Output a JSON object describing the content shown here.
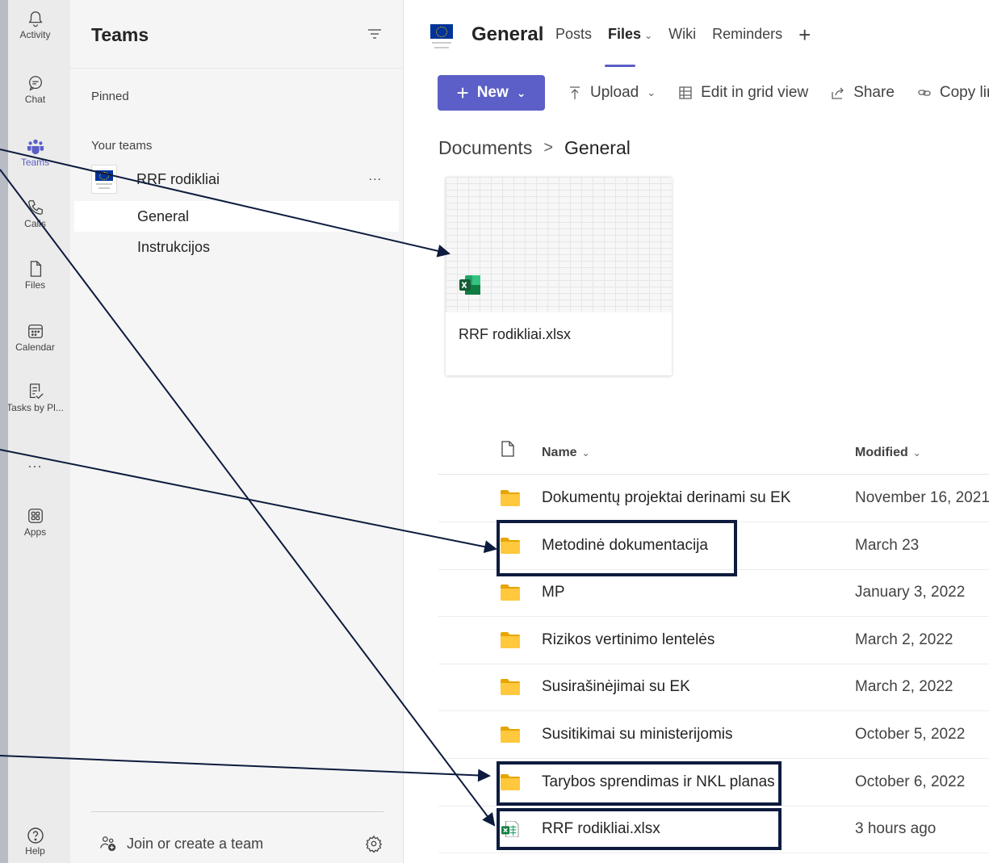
{
  "rail": {
    "items": [
      {
        "label": "Activity",
        "icon": "bell-icon"
      },
      {
        "label": "Chat",
        "icon": "chat-icon"
      },
      {
        "label": "Teams",
        "icon": "teams-icon",
        "active": true
      },
      {
        "label": "Calls",
        "icon": "phone-icon"
      },
      {
        "label": "Files",
        "icon": "file-icon"
      },
      {
        "label": "Calendar",
        "icon": "calendar-icon"
      },
      {
        "label": "Tasks by Pl...",
        "icon": "tasks-icon"
      },
      {
        "label": "Apps",
        "icon": "apps-icon"
      }
    ],
    "more_label": "...",
    "help_label": "Help"
  },
  "teams_panel": {
    "title": "Teams",
    "pinned_label": "Pinned",
    "your_teams_label": "Your teams",
    "team": {
      "name": "RRF rodikliai",
      "more": "..."
    },
    "channels": [
      {
        "label": "General",
        "active": true
      },
      {
        "label": "Instrukcijos",
        "active": false
      }
    ],
    "join_label": "Join or create a team"
  },
  "header": {
    "channel_title": "General",
    "tabs": [
      {
        "label": "Posts",
        "active": false
      },
      {
        "label": "Files",
        "active": true,
        "has_chevron": true
      },
      {
        "label": "Wiki",
        "active": false
      },
      {
        "label": "Reminders",
        "active": false
      }
    ],
    "add_tab": "+"
  },
  "toolbar": {
    "new_label": "New",
    "upload_label": "Upload",
    "grid_label": "Edit in grid view",
    "share_label": "Share",
    "copy_label": "Copy lir"
  },
  "breadcrumb": {
    "root": "Documents",
    "separator": ">",
    "current": "General"
  },
  "highlight_card": {
    "file_name": "RRF rodikliai.xlsx"
  },
  "list": {
    "col_name": "Name",
    "col_modified": "Modified",
    "rows": [
      {
        "name": "Dokumentų projektai derinami su EK",
        "modified": "November 16, 2021",
        "type": "folder"
      },
      {
        "name": "Metodinė dokumentacija",
        "modified": "March 23",
        "type": "folder"
      },
      {
        "name": "MP",
        "modified": "January 3, 2022",
        "type": "folder"
      },
      {
        "name": "Rizikos vertinimo lentelės",
        "modified": "March 2, 2022",
        "type": "folder"
      },
      {
        "name": "Susirašinėjimai su EK",
        "modified": "March 2, 2022",
        "type": "folder"
      },
      {
        "name": "Susitikimai su ministerijomis",
        "modified": "October 5, 2022",
        "type": "folder"
      },
      {
        "name": "Tarybos sprendimas ir NKL planas",
        "modified": "October 6, 2022",
        "type": "folder"
      },
      {
        "name": "RRF rodikliai.xlsx",
        "modified": "3 hours ago",
        "type": "excel"
      }
    ]
  },
  "colors": {
    "accent": "#5b5fc7",
    "folder": "#ffc83d",
    "excel": "#107c41",
    "annotation": "#0d1b3e"
  }
}
